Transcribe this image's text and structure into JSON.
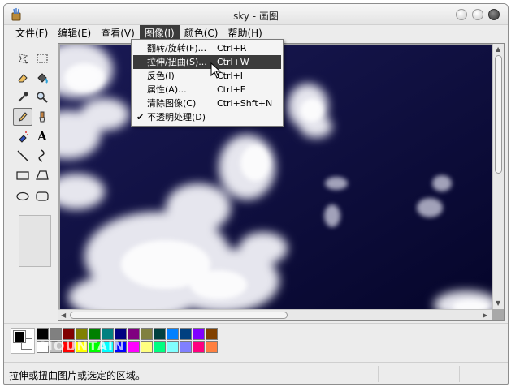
{
  "window": {
    "title": "sky - 画图"
  },
  "menubar": {
    "items": [
      {
        "label": "文件(F)"
      },
      {
        "label": "编辑(E)"
      },
      {
        "label": "查看(V)"
      },
      {
        "label": "图像(I)"
      },
      {
        "label": "颜色(C)"
      },
      {
        "label": "帮助(H)"
      }
    ],
    "open_menu": "图像(I)"
  },
  "image_menu": {
    "items": [
      {
        "label": "翻转/旋转(F)...",
        "shortcut": "Ctrl+R"
      },
      {
        "label": "拉伸/扭曲(S)...",
        "shortcut": "Ctrl+W",
        "highlighted": true
      },
      {
        "label": "反色(I)",
        "shortcut": "Ctrl+I"
      },
      {
        "label": "属性(A)...",
        "shortcut": "Ctrl+E"
      },
      {
        "label": "清除图像(C)",
        "shortcut": "Ctrl+Shft+N"
      },
      {
        "label": "不透明处理(D)",
        "shortcut": "",
        "checked": true,
        "check_mark": "✔"
      }
    ]
  },
  "toolbox": {
    "tools": [
      {
        "name": "free-select-icon"
      },
      {
        "name": "rect-select-icon"
      },
      {
        "name": "eraser-icon"
      },
      {
        "name": "fill-bucket-icon"
      },
      {
        "name": "color-picker-icon"
      },
      {
        "name": "magnifier-icon"
      },
      {
        "name": "pencil-icon",
        "selected": true
      },
      {
        "name": "brush-icon"
      },
      {
        "name": "airbrush-icon"
      },
      {
        "name": "text-icon",
        "glyph": "A"
      },
      {
        "name": "line-icon"
      },
      {
        "name": "curve-icon"
      },
      {
        "name": "rectangle-icon"
      },
      {
        "name": "polygon-icon"
      },
      {
        "name": "ellipse-icon"
      },
      {
        "name": "rounded-rect-icon"
      }
    ]
  },
  "palette": {
    "foreground": "#000000",
    "background": "#ffffff",
    "row1": [
      "#000000",
      "#808080",
      "#800000",
      "#808000",
      "#008000",
      "#008080",
      "#000080",
      "#800080",
      "#808040",
      "#004040",
      "#0080ff",
      "#004080",
      "#8000ff",
      "#804000"
    ],
    "row2": [
      "#ffffff",
      "#c0c0c0",
      "#ff0000",
      "#ffff00",
      "#00ff00",
      "#00ffff",
      "#0000ff",
      "#ff00ff",
      "#ffff80",
      "#00ff80",
      "#80ffff",
      "#8080ff",
      "#ff0080",
      "#ff8040"
    ],
    "watermark": "MOUNTAIN"
  },
  "statusbar": {
    "text": "拉伸或扭曲图片或选定的区域。"
  },
  "colors": {
    "menu_highlight": "#3b3b3b",
    "sky": "#0d0d3d"
  }
}
